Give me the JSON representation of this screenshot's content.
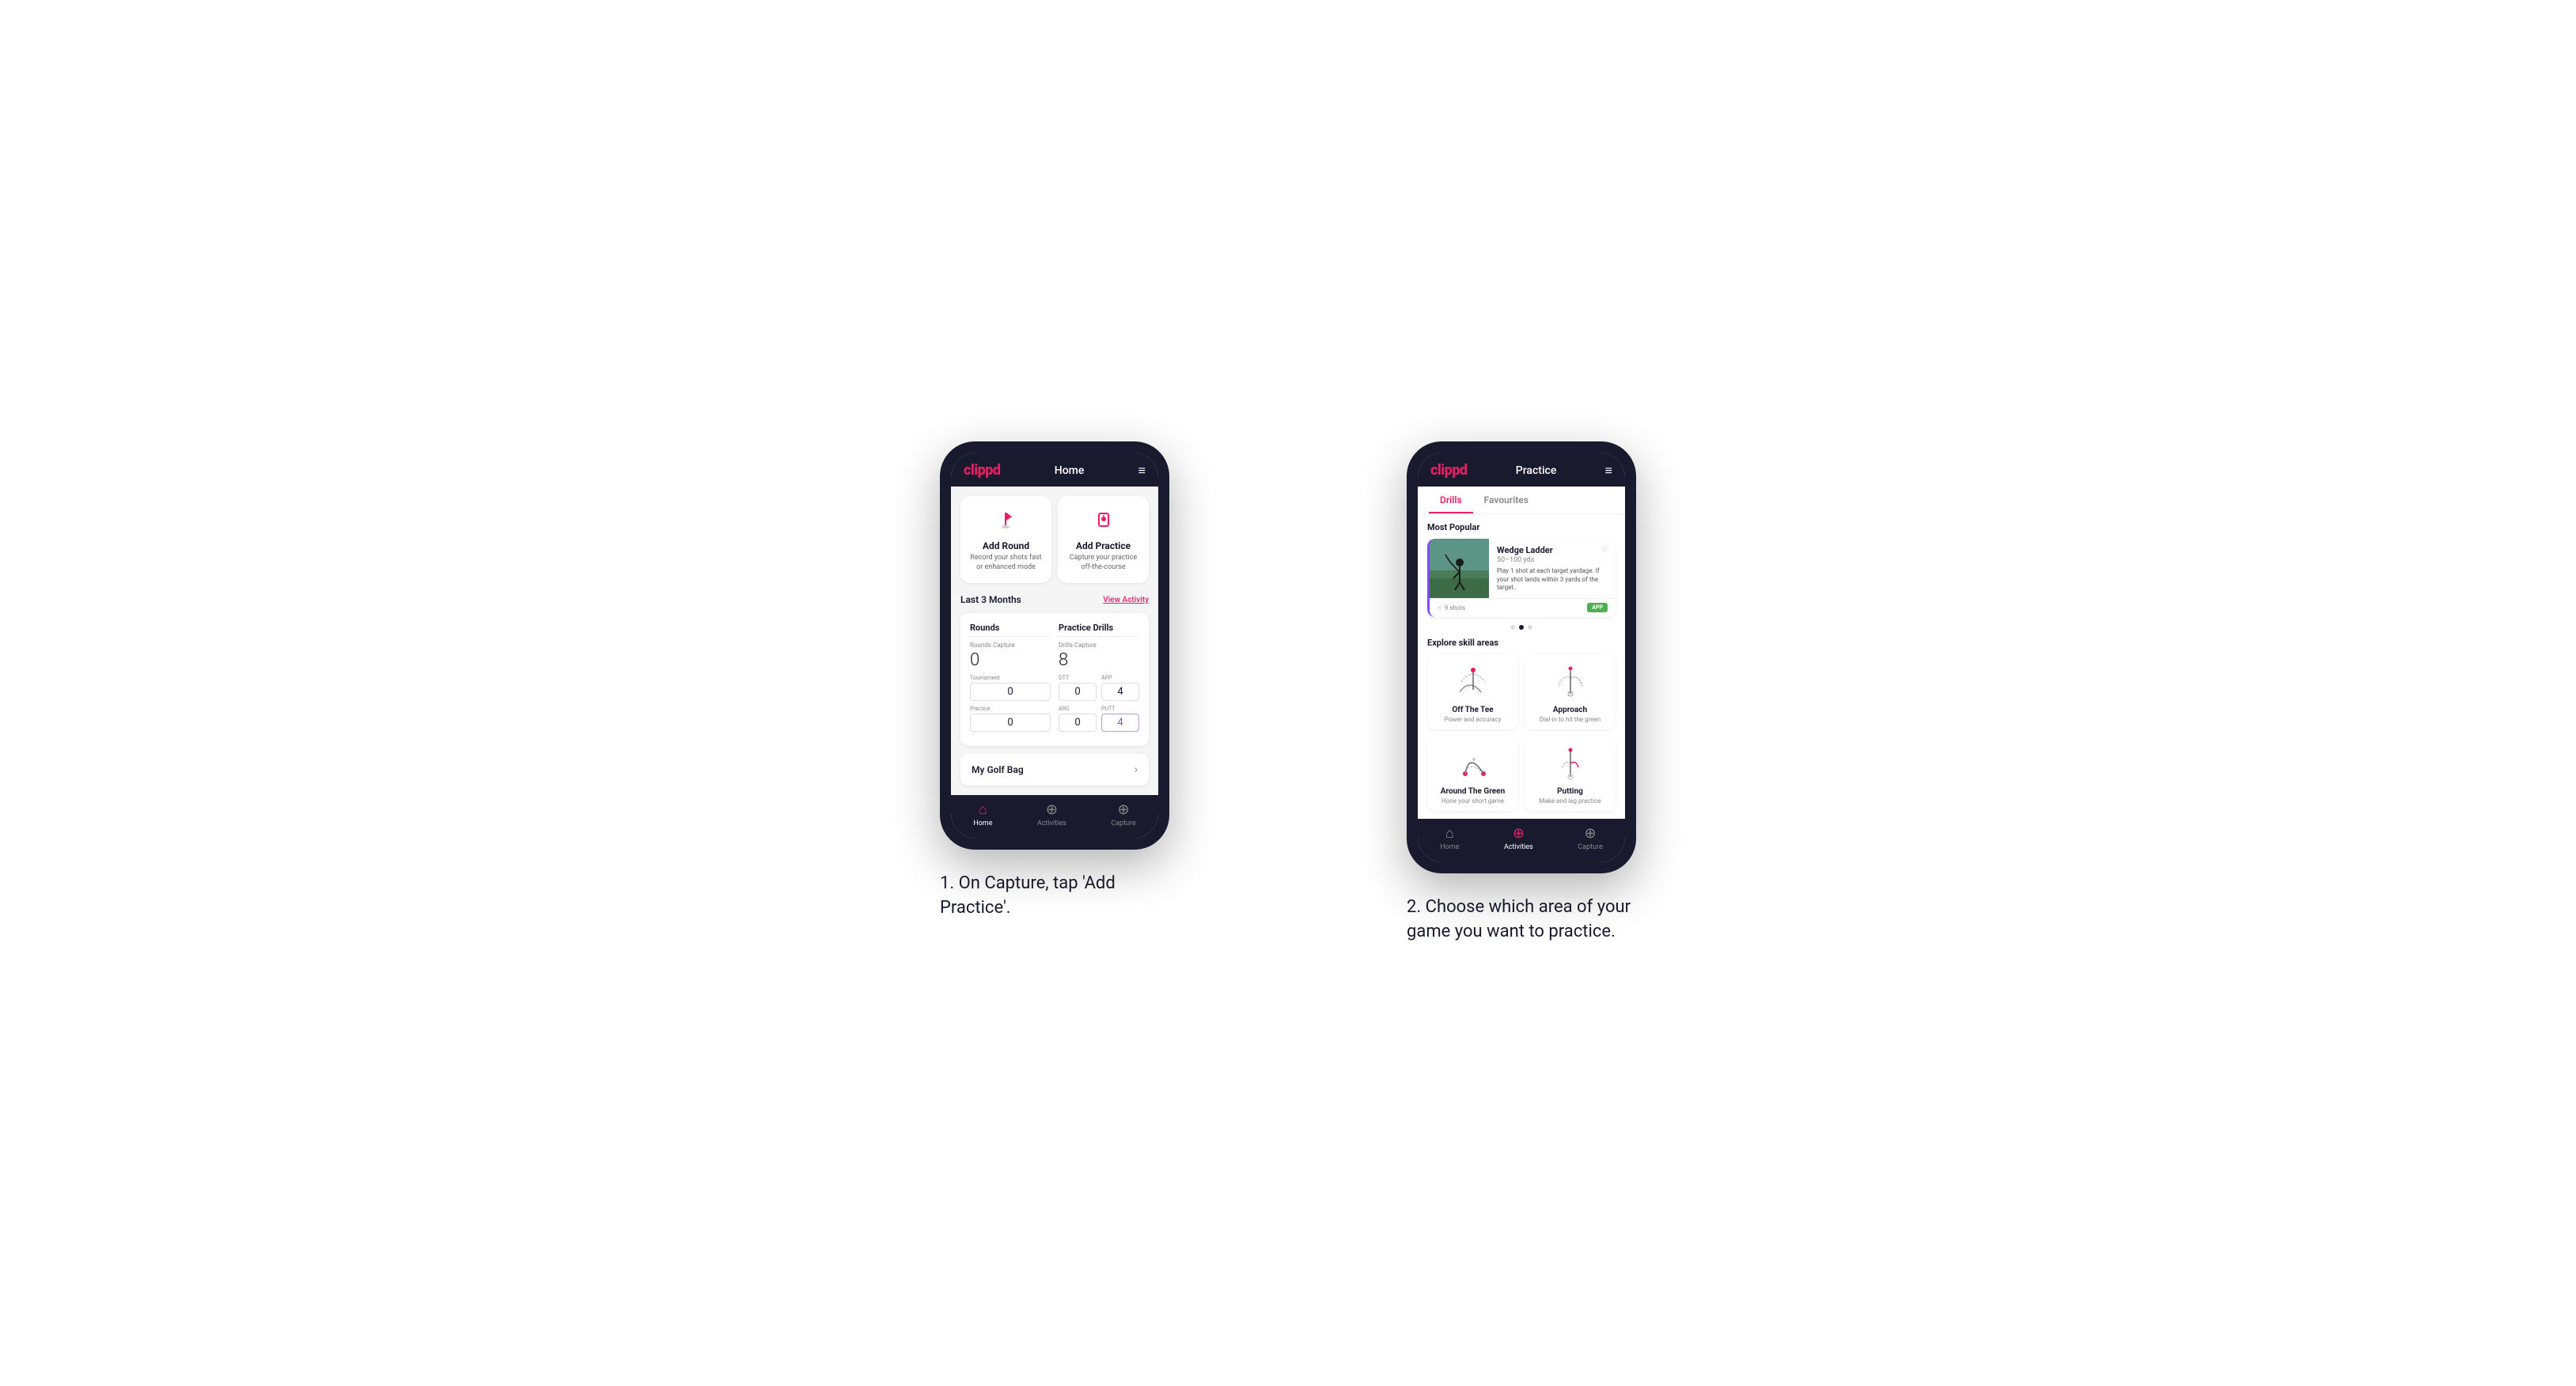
{
  "phone1": {
    "header": {
      "logo": "clippd",
      "title": "Home",
      "menu_icon": "≡"
    },
    "action_cards": [
      {
        "id": "add-round",
        "title": "Add Round",
        "description": "Record your shots fast or enhanced mode",
        "icon": "flag"
      },
      {
        "id": "add-practice",
        "title": "Add Practice",
        "description": "Capture your practice off-the-course",
        "icon": "target"
      }
    ],
    "stats_section": {
      "title": "Last 3 Months",
      "link": "View Activity",
      "rounds": {
        "label": "Rounds",
        "capture_label": "Rounds Capture",
        "total": "0",
        "sub_stats": [
          {
            "label": "Tournament",
            "value": "0"
          },
          {
            "label": "Practice",
            "value": "0"
          }
        ]
      },
      "practice_drills": {
        "label": "Practice Drills",
        "capture_label": "Drills Capture",
        "total": "8",
        "sub_stats": [
          {
            "label": "OTT",
            "value": "0"
          },
          {
            "label": "APP",
            "value": "4",
            "highlight": false
          },
          {
            "label": "ARG",
            "value": "0"
          },
          {
            "label": "PUTT",
            "value": "4",
            "highlight": true
          }
        ]
      }
    },
    "golf_bag": {
      "label": "My Golf Bag"
    },
    "bottom_nav": [
      {
        "label": "Home",
        "active": true,
        "icon": "home"
      },
      {
        "label": "Activities",
        "active": false,
        "icon": "activities"
      },
      {
        "label": "Capture",
        "active": false,
        "icon": "capture"
      }
    ]
  },
  "phone2": {
    "header": {
      "logo": "clippd",
      "title": "Practice",
      "menu_icon": "≡"
    },
    "tabs": [
      {
        "label": "Drills",
        "active": true
      },
      {
        "label": "Favourites",
        "active": false
      }
    ],
    "most_popular": {
      "title": "Most Popular",
      "featured": {
        "title": "Wedge Ladder",
        "yds": "50–100 yds",
        "description": "Play 1 shot at each target yardage. If your shot lands within 3 yards of the target..",
        "shots": "9 shots",
        "badge": "APP"
      },
      "dots": [
        {
          "active": false
        },
        {
          "active": true
        },
        {
          "active": false
        }
      ]
    },
    "explore": {
      "title": "Explore skill areas",
      "skills": [
        {
          "id": "off-the-tee",
          "name": "Off The Tee",
          "desc": "Power and accuracy"
        },
        {
          "id": "approach",
          "name": "Approach",
          "desc": "Dial-in to hit the green"
        },
        {
          "id": "around-the-green",
          "name": "Around The Green",
          "desc": "Hone your short game"
        },
        {
          "id": "putting",
          "name": "Putting",
          "desc": "Make and lag practice"
        }
      ]
    },
    "bottom_nav": [
      {
        "label": "Home",
        "active": false,
        "icon": "home"
      },
      {
        "label": "Activities",
        "active": true,
        "icon": "activities"
      },
      {
        "label": "Capture",
        "active": false,
        "icon": "capture"
      }
    ]
  },
  "captions": [
    {
      "number": "1.",
      "text": "On Capture, tap 'Add Practice'."
    },
    {
      "number": "2.",
      "text": "Choose which area of your game you want to practice."
    }
  ]
}
